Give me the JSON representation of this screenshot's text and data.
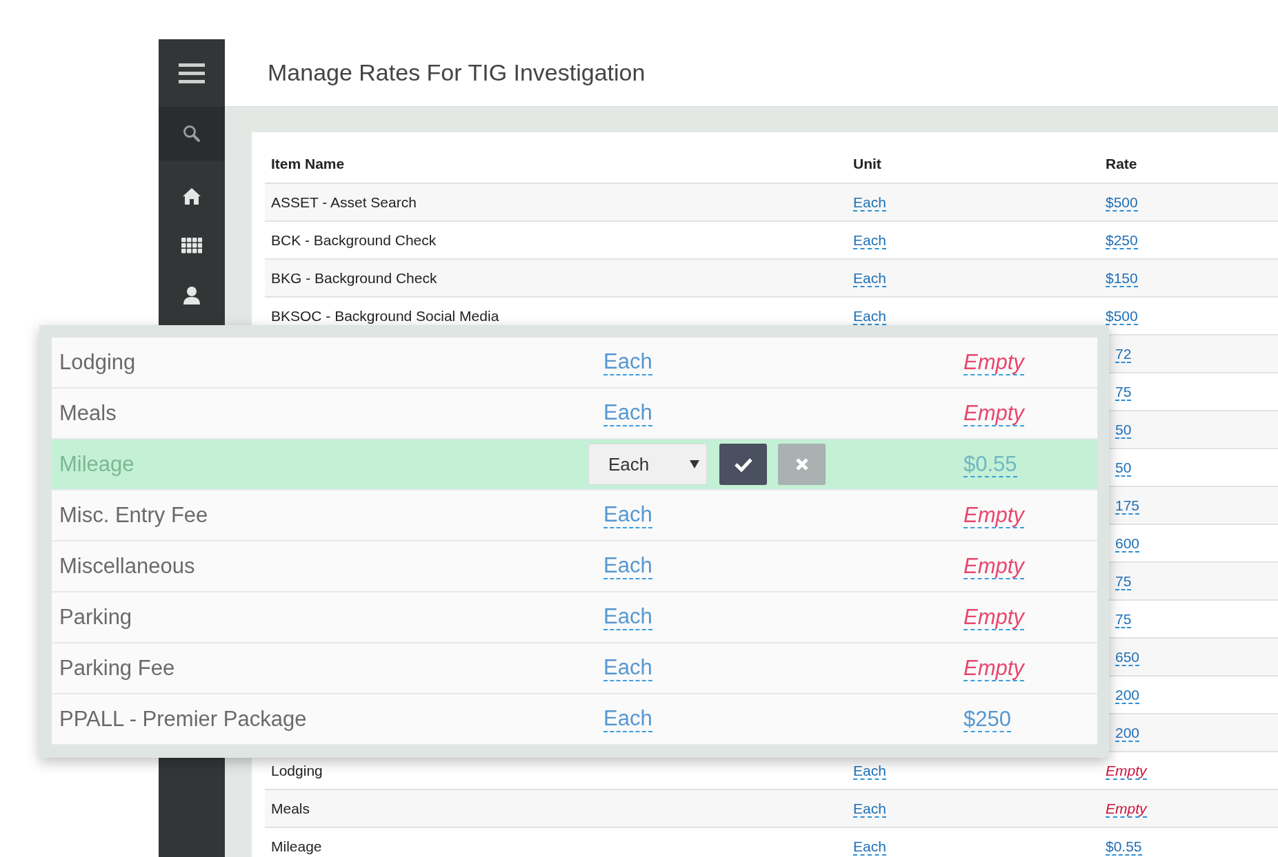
{
  "title": "Manage Rates For TIG Investigation",
  "table": {
    "columns": [
      "Item Name",
      "Unit",
      "Rate"
    ],
    "rows": [
      {
        "name": "ASSET - Asset Search",
        "unit": "Each",
        "rate": "$500",
        "kind": "amount"
      },
      {
        "name": "BCK - Background Check",
        "unit": "Each",
        "rate": "$250",
        "kind": "amount"
      },
      {
        "name": "BKG - Background Check",
        "unit": "Each",
        "rate": "$150",
        "kind": "amount"
      },
      {
        "name": "BKSOC - Background Social Media",
        "unit": "Each",
        "rate": "$500",
        "kind": "amount"
      },
      {
        "rate": "72",
        "kind": "amount"
      },
      {
        "rate": "75",
        "kind": "amount"
      },
      {
        "rate": "50",
        "kind": "amount"
      },
      {
        "rate": "50",
        "kind": "amount"
      },
      {
        "rate": "175",
        "kind": "amount"
      },
      {
        "rate": "600",
        "kind": "amount"
      },
      {
        "rate": "75",
        "kind": "amount"
      },
      {
        "rate": "75",
        "kind": "amount"
      },
      {
        "rate": "650",
        "kind": "amount"
      },
      {
        "rate": "200",
        "kind": "amount"
      },
      {
        "rate": "200",
        "kind": "amount"
      },
      {
        "name": "Lodging",
        "unit": "Each",
        "rate": "Empty",
        "kind": "empty"
      },
      {
        "name": "Meals",
        "unit": "Each",
        "rate": "Empty",
        "kind": "empty"
      },
      {
        "name": "Mileage",
        "unit": "Each",
        "rate": "$0.55",
        "kind": "amount"
      }
    ]
  },
  "edit_popup": {
    "rows": [
      {
        "name": "Lodging",
        "unit": "Each",
        "rate": "Empty",
        "kind": "empty",
        "editing": false
      },
      {
        "name": "Meals",
        "unit": "Each",
        "rate": "Empty",
        "kind": "empty",
        "editing": false
      },
      {
        "name": "Mileage",
        "unit": "Each",
        "rate": "$0.55",
        "kind": "amount",
        "editing": true
      },
      {
        "name": "Misc. Entry Fee",
        "unit": "Each",
        "rate": "Empty",
        "kind": "empty",
        "editing": false
      },
      {
        "name": "Miscellaneous",
        "unit": "Each",
        "rate": "Empty",
        "kind": "empty",
        "editing": false
      },
      {
        "name": "Parking",
        "unit": "Each",
        "rate": "Empty",
        "kind": "empty",
        "editing": false
      },
      {
        "name": "Parking Fee",
        "unit": "Each",
        "rate": "Empty",
        "kind": "empty",
        "editing": false
      },
      {
        "name": "PPALL - Premier Package",
        "unit": "Each",
        "rate": "$250",
        "kind": "amount",
        "editing": false
      }
    ]
  }
}
